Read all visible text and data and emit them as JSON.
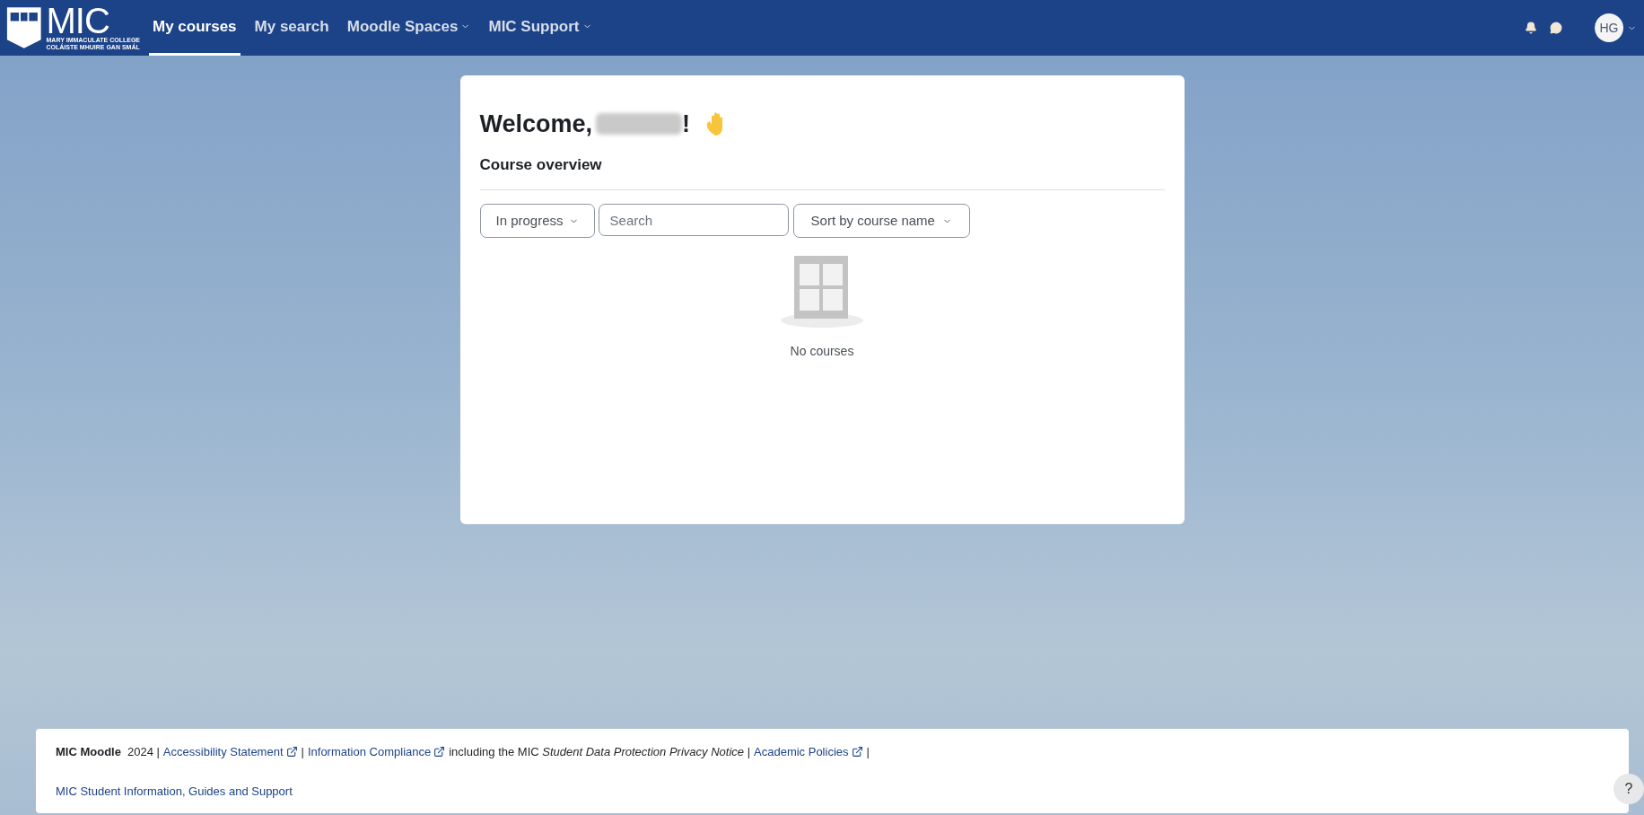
{
  "navbar": {
    "logo_text": "MIC",
    "logo_subtitle": [
      "MARY IMMACULATE COLLEGE",
      "COLÁISTE MHUIRE GAN SMÁL"
    ],
    "items": [
      {
        "label": "My courses",
        "selected": true,
        "dropdown": false
      },
      {
        "label": "My search",
        "selected": false,
        "dropdown": false
      },
      {
        "label": "Moodle Spaces",
        "selected": false,
        "dropdown": true
      },
      {
        "label": "MIC Support",
        "selected": false,
        "dropdown": true
      }
    ],
    "avatar_initials": "HG"
  },
  "card": {
    "greeting": "Welcome,",
    "greeting_end": "!",
    "heading": "Course overview",
    "filter": "In progress",
    "search_placeholder": "Search",
    "sort": "Sort by course name",
    "empty_text": "No courses"
  },
  "footer": {
    "line_1": [
      {
        "kind": "brand",
        "text": "MIC Moodle"
      },
      {
        "kind": "text",
        "text": "2024 |"
      },
      {
        "kind": "link",
        "text": "Accessibility Statement"
      },
      {
        "kind": "text",
        "text": "|"
      },
      {
        "kind": "link",
        "text": "Information Compliance"
      },
      {
        "kind": "text",
        "text": "including the MIC *Student Data Protection Privacy Notice* |"
      },
      {
        "kind": "link",
        "text": "Academic Policies"
      },
      {
        "kind": "text",
        "text": "|"
      }
    ],
    "line_2": "MIC Student Information, Guides and Support"
  },
  "help_button": "?"
}
